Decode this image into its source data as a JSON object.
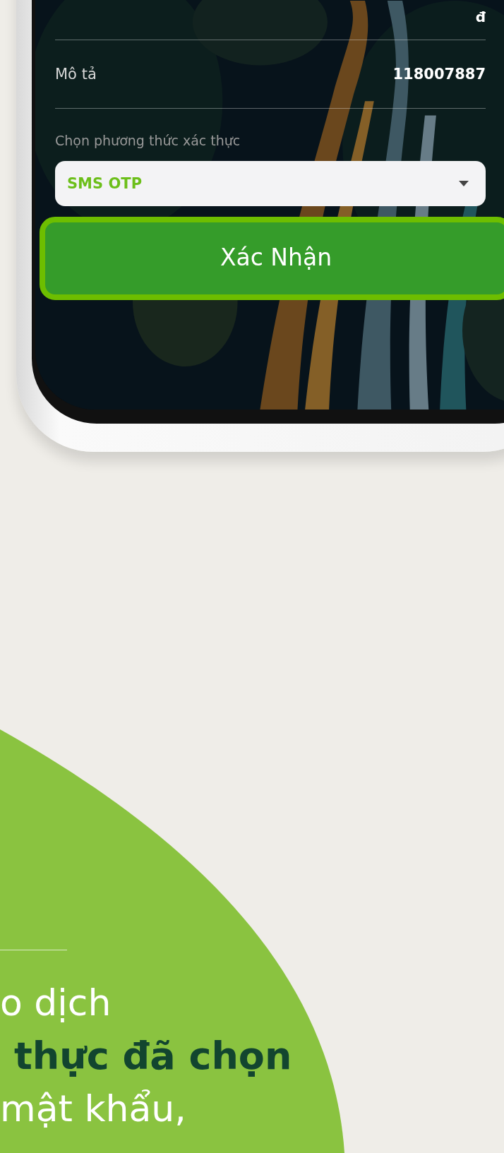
{
  "transaction": {
    "amount_unit": "đ",
    "rows": [
      {
        "label": "Mô tả",
        "value": "118007887"
      }
    ]
  },
  "auth": {
    "label": "Chọn phương thức xác thực",
    "method": "SMS OTP"
  },
  "confirm_button": "Xác Nhận",
  "caption": {
    "lines": [
      {
        "text": "o dịch",
        "bold": false
      },
      {
        "text": "thực đã chọn",
        "bold": true
      },
      {
        "text": "mật khẩu,",
        "bold": false
      }
    ]
  }
}
